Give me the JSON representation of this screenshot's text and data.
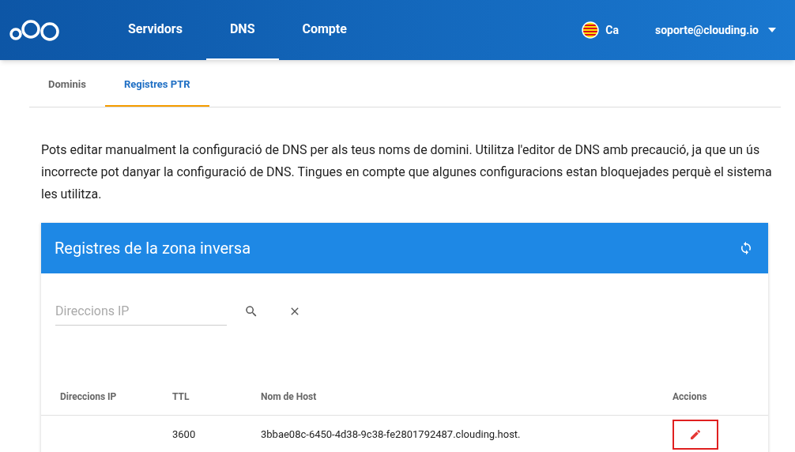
{
  "nav": {
    "items": [
      {
        "label": "Servidors",
        "selected": false
      },
      {
        "label": "DNS",
        "selected": true
      },
      {
        "label": "Compte",
        "selected": false
      }
    ],
    "language": "Ca",
    "user": "soporte@clouding.io"
  },
  "subtabs": [
    {
      "label": "Dominis",
      "selected": false
    },
    {
      "label": "Registres PTR",
      "selected": true
    }
  ],
  "intro": "Pots editar manualment la configuració de DNS per als teus noms de domini. Utilitza l'editor de DNS amb precaució, ja que un ús incorrecte pot danyar la configuració de DNS. Tingues en compte que algunes configuracions estan bloquejades perquè el sistema les utilitza.",
  "card": {
    "title": "Registres de la zona inversa",
    "search": {
      "placeholder": "Direccions IP"
    },
    "table": {
      "columns": [
        "Direccions IP",
        "TTL",
        "Nom de Host",
        "Accions"
      ],
      "rows": [
        {
          "ttl": "3600",
          "host": "3bbae08c-6450-4d38-9c38-fe2801792487.clouding.host.",
          "edit_highlighted": true
        }
      ]
    }
  }
}
